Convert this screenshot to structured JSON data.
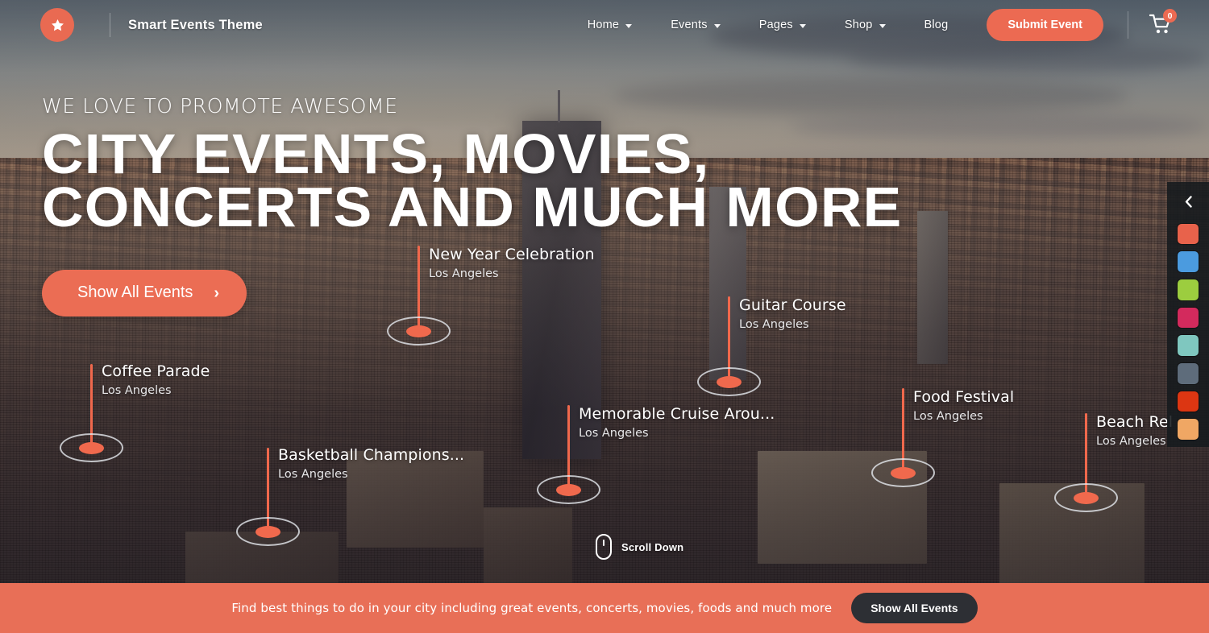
{
  "header": {
    "logo_icon": "star-icon",
    "brand_name": "Smart Events Theme",
    "nav_items": [
      {
        "label": "Home",
        "has_dropdown": true
      },
      {
        "label": "Events",
        "has_dropdown": true
      },
      {
        "label": "Pages",
        "has_dropdown": true
      },
      {
        "label": "Shop",
        "has_dropdown": true
      },
      {
        "label": "Blog",
        "has_dropdown": false
      }
    ],
    "submit_label": "Submit Event",
    "cart_icon": "shopping-cart-icon",
    "cart_count": "0"
  },
  "hero": {
    "eyebrow": "WE LOVE TO PROMOTE AWESOME",
    "title": "CITY EVENTS, MOVIES,\nCONCERTS AND MUCH MORE",
    "cta_label": "Show All Events",
    "cta_chevron": "›"
  },
  "map_pins": [
    {
      "title": "Coffee Parade",
      "city": "Los Angeles"
    },
    {
      "title": "New Year Celebration",
      "city": "Los Angeles"
    },
    {
      "title": "Basketball Champions...",
      "city": "Los Angeles"
    },
    {
      "title": "Guitar Course",
      "city": "Los Angeles"
    },
    {
      "title": "Memorable Cruise Arou...",
      "city": "Los Angeles"
    },
    {
      "title": "Food Festival",
      "city": "Los Angeles"
    },
    {
      "title": "Beach Rel",
      "city": "Los Angeles"
    }
  ],
  "scroll": {
    "icon": "mouse-icon",
    "label": "Scroll Down"
  },
  "switcher": {
    "toggle_icon": "chevron-left-icon",
    "colors": [
      "#e8624b",
      "#4b9bdf",
      "#9ccd3f",
      "#d32a5d",
      "#7fc7bf",
      "#5e6c7b",
      "#dc3612",
      "#f0a764"
    ]
  },
  "bottom_bar": {
    "text": "Find best things to do in your city including great events, concerts, movies, foods and much more",
    "button_label": "Show All Events",
    "background_color": "#e86f57"
  },
  "theme": {
    "accent": "#ec6a52",
    "dark": "#2d2f34"
  }
}
